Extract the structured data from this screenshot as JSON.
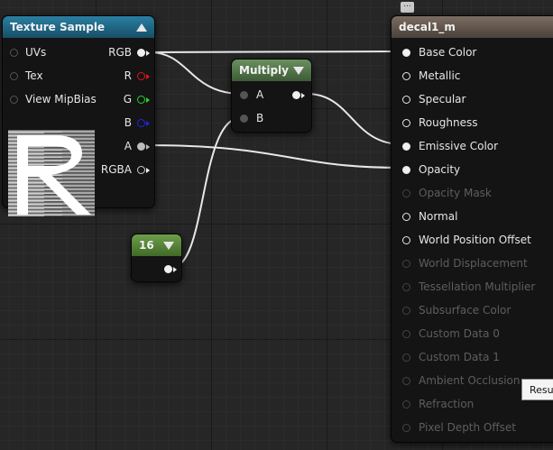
{
  "texture_node": {
    "title": "Texture Sample",
    "inputs": [
      {
        "label": "UVs"
      },
      {
        "label": "Tex"
      },
      {
        "label": "View MipBias"
      }
    ],
    "outputs": [
      {
        "label": "RGB",
        "color": "#f0f0f0"
      },
      {
        "label": "R",
        "color": "#e0141e"
      },
      {
        "label": "G",
        "color": "#2ad22a"
      },
      {
        "label": "B",
        "color": "#2424e6"
      },
      {
        "label": "A",
        "color": "#bdbdbd"
      },
      {
        "label": "RGBA",
        "color": "#f0f0f0"
      }
    ],
    "header_color": "#1f6e8e"
  },
  "multiply_node": {
    "title": "Multiply",
    "inputs": [
      {
        "label": "A"
      },
      {
        "label": "B"
      }
    ],
    "header_color": "#56764d"
  },
  "constant_node": {
    "title": "16",
    "header_color": "#5d8a3c"
  },
  "material_node": {
    "title": "decal1_m",
    "header_color": "#6e6258",
    "inputs": [
      {
        "label": "Base Color",
        "enabled": true,
        "connected": true
      },
      {
        "label": "Metallic",
        "enabled": true,
        "connected": false
      },
      {
        "label": "Specular",
        "enabled": true,
        "connected": false
      },
      {
        "label": "Roughness",
        "enabled": true,
        "connected": false
      },
      {
        "label": "Emissive Color",
        "enabled": true,
        "connected": true
      },
      {
        "label": "Opacity",
        "enabled": true,
        "connected": true
      },
      {
        "label": "Opacity Mask",
        "enabled": false,
        "connected": false
      },
      {
        "label": "Normal",
        "enabled": true,
        "connected": false
      },
      {
        "label": "World Position Offset",
        "enabled": true,
        "connected": false
      },
      {
        "label": "World Displacement",
        "enabled": false,
        "connected": false
      },
      {
        "label": "Tessellation Multiplier",
        "enabled": false,
        "connected": false
      },
      {
        "label": "Subsurface Color",
        "enabled": false,
        "connected": false
      },
      {
        "label": "Custom Data 0",
        "enabled": false,
        "connected": false
      },
      {
        "label": "Custom Data 1",
        "enabled": false,
        "connected": false
      },
      {
        "label": "Ambient Occlusion",
        "enabled": false,
        "connected": false
      },
      {
        "label": "Refraction",
        "enabled": false,
        "connected": false
      },
      {
        "label": "Pixel Depth Offset",
        "enabled": false,
        "connected": false
      }
    ]
  },
  "tooltip": {
    "text": "Resu"
  },
  "wire_color": "#e8e8e8"
}
